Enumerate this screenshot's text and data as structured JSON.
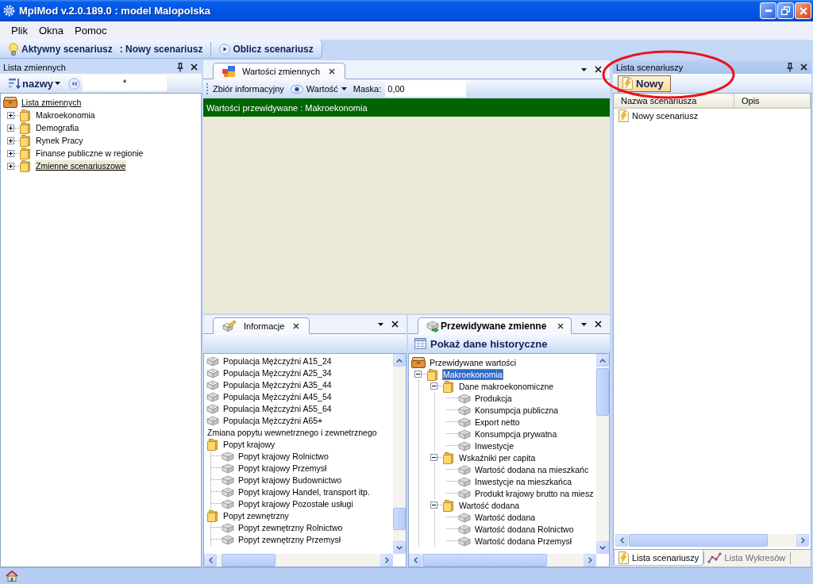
{
  "window": {
    "title": "MplMod v.2.0.189.0 : model Malopolska"
  },
  "menu": [
    {
      "label": "Plik"
    },
    {
      "label": "Okna"
    },
    {
      "label": "Pomoc"
    }
  ],
  "toolbar": {
    "active_label": "Aktywny scenariusz",
    "active_value": ": Nowy scenariusz",
    "run_button": "Oblicz scenariusz"
  },
  "variables_panel": {
    "title": "Lista zmiennych",
    "sort_button": "nazwy",
    "filter_value": "*",
    "tree": [
      {
        "kind": "root",
        "label": "Lista zmiennych",
        "selected": false,
        "children": [
          {
            "kind": "folder",
            "label": "Makroekonomia",
            "expanded": false,
            "selected": false
          },
          {
            "kind": "folder",
            "label": "Demografia",
            "expanded": false,
            "selected": false
          },
          {
            "kind": "folder",
            "label": "Rynek Pracy",
            "expanded": false,
            "selected": false
          },
          {
            "kind": "folder",
            "label": "Finanse publiczne w regionie",
            "expanded": false,
            "selected": false
          },
          {
            "kind": "folder",
            "label": "Zmienne scenariuszowe",
            "expanded": false,
            "selected": true
          }
        ]
      }
    ]
  },
  "values_document": {
    "tab": "Wartości zmiennych",
    "dataset_label": "Zbiór informacyjny",
    "view_button": "Wartość",
    "mask_label": "Maska:",
    "mask_value": "0,00",
    "banner": "Wartości przewidywane : Makroekonomia"
  },
  "info_panel": {
    "tab": "Informacje",
    "items": [
      {
        "kind": "variable",
        "label": "Populacja Mężczyźni A15_24"
      },
      {
        "kind": "variable",
        "label": "Populacja Mężczyźni A25_34"
      },
      {
        "kind": "variable",
        "label": "Populacja Mężczyźni A35_44"
      },
      {
        "kind": "variable",
        "label": "Populacja Mężczyźni A45_54"
      },
      {
        "kind": "variable",
        "label": "Populacja Mężczyźni A55_64"
      },
      {
        "kind": "variable",
        "label": "Populacja Mężczyźni A65+"
      },
      {
        "kind": "group",
        "label": "Zmiana popytu wewnetrznego i zewnetrznego"
      },
      {
        "kind": "folder",
        "label": "Popyt krajowy",
        "children": [
          {
            "kind": "variable",
            "label": "Popyt krajowy Rolnictwo"
          },
          {
            "kind": "variable",
            "label": "Popyt krajowy Przemysł"
          },
          {
            "kind": "variable",
            "label": "Popyt krajowy Budownictwo"
          },
          {
            "kind": "variable",
            "label": "Popyt krajowy Handel, transport itp."
          },
          {
            "kind": "variable",
            "label": "Popyt krajowy Pozostałe usługi"
          }
        ]
      },
      {
        "kind": "folder",
        "label": "Popyt zewnętrzny",
        "children": [
          {
            "kind": "variable",
            "label": "Popyt zewnętrzny Rolnictwo"
          },
          {
            "kind": "variable",
            "label": "Popyt zewnętrzny Przemysł"
          }
        ]
      }
    ]
  },
  "forecast_panel": {
    "tab": "Przewidywane zmienne",
    "history_button": "Pokaż dane historyczne",
    "tree": [
      {
        "kind": "root",
        "label": "Przewidywane wartości",
        "selected": false,
        "children": [
          {
            "kind": "folder",
            "label": "Makroekonomia",
            "expanded": true,
            "selected": true,
            "children": [
              {
                "kind": "folder",
                "label": "Dane makroekonomiczne",
                "expanded": true,
                "selected": false,
                "children": [
                  {
                    "kind": "variable",
                    "label": "Produkcja",
                    "selected": false
                  },
                  {
                    "kind": "variable",
                    "label": "Konsumpcja publiczna",
                    "selected": false
                  },
                  {
                    "kind": "variable",
                    "label": "Export netto",
                    "selected": false
                  },
                  {
                    "kind": "variable",
                    "label": "Konsumpcja prywatna",
                    "selected": false
                  },
                  {
                    "kind": "variable",
                    "label": "Inwestycje",
                    "selected": false
                  }
                ]
              },
              {
                "kind": "folder",
                "label": "Wskaźniki per capita",
                "expanded": true,
                "selected": false,
                "children": [
                  {
                    "kind": "variable",
                    "label": "Wartość dodana na mieszkańc",
                    "selected": false
                  },
                  {
                    "kind": "variable",
                    "label": "Inwestycje na mieszkańca",
                    "selected": false
                  },
                  {
                    "kind": "variable",
                    "label": "Produkt krajowy brutto na miesz",
                    "selected": false
                  }
                ]
              },
              {
                "kind": "folder",
                "label": "Wartość dodana",
                "expanded": true,
                "selected": false,
                "children": [
                  {
                    "kind": "variable",
                    "label": "Wartość dodana",
                    "selected": false
                  },
                  {
                    "kind": "variable",
                    "label": "Wartość dodana Rolnictwo",
                    "selected": false
                  },
                  {
                    "kind": "variable",
                    "label": "Wartość dodana Przemysł",
                    "selected": false
                  }
                ]
              }
            ]
          }
        ]
      }
    ]
  },
  "scenario_panel": {
    "title": "Lista scenariuszy",
    "new_button": "Nowy",
    "columns": [
      {
        "label": "Nazwa scenariusza"
      },
      {
        "label": "Opis"
      }
    ],
    "rows": [
      {
        "name": "Nowy scenariusz"
      }
    ],
    "tabs": [
      {
        "kind": "scenarios",
        "label": "Lista scenariuszy",
        "selected": true
      },
      {
        "kind": "charts",
        "label": "Lista Wykresów",
        "selected": false
      }
    ]
  }
}
